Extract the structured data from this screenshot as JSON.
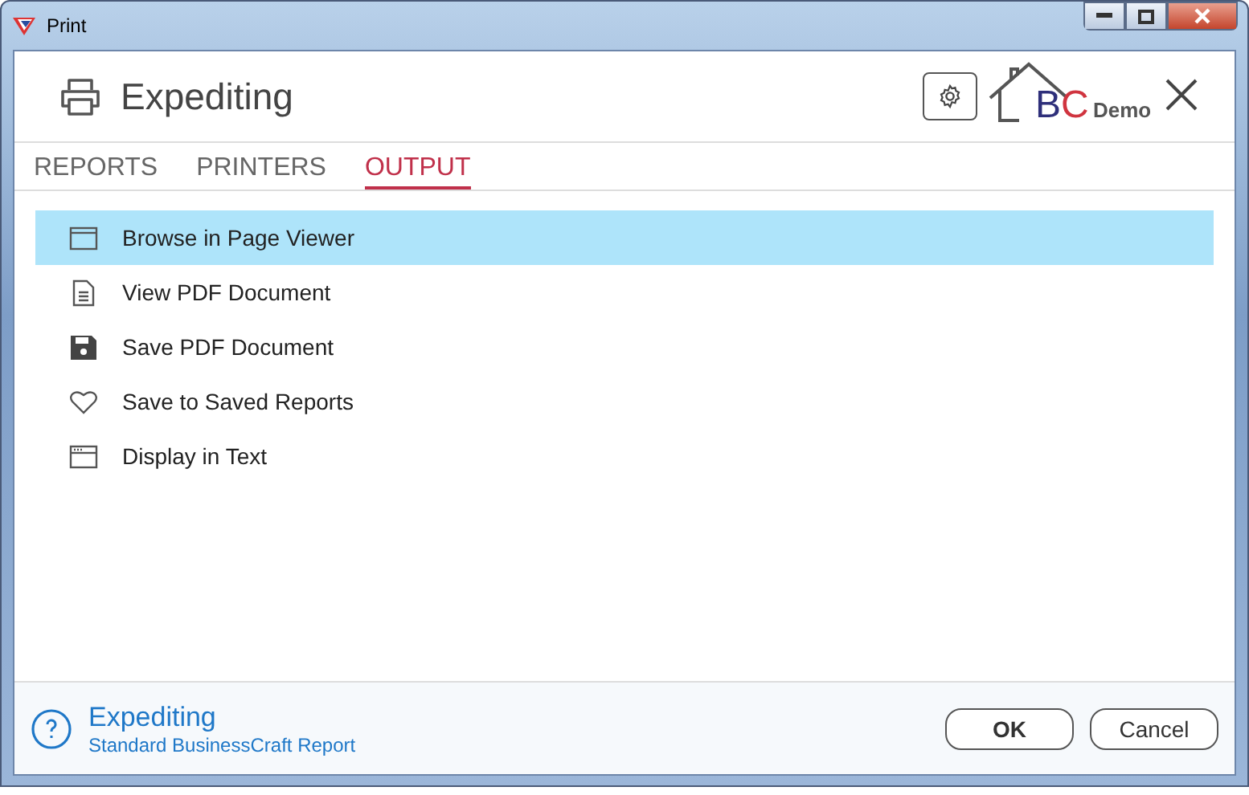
{
  "window": {
    "title": "Print"
  },
  "header": {
    "title": "Expediting",
    "logo": {
      "letters": [
        "B",
        "C"
      ],
      "caption": "Demo"
    }
  },
  "tabs": [
    {
      "label": "REPORTS",
      "selected": false
    },
    {
      "label": "PRINTERS",
      "selected": false
    },
    {
      "label": "OUTPUT",
      "selected": true
    }
  ],
  "outputs": [
    {
      "label": "Browse in Page Viewer",
      "kind": "window",
      "selected": true
    },
    {
      "label": "View PDF Document",
      "kind": "document",
      "selected": false
    },
    {
      "label": "Save PDF Document",
      "kind": "disk",
      "selected": false
    },
    {
      "label": "Save to Saved Reports",
      "kind": "heart",
      "selected": false
    },
    {
      "label": "Display in Text",
      "kind": "text",
      "selected": false
    }
  ],
  "footer": {
    "title": "Expediting",
    "subtitle": "Standard BusinessCraft Report"
  },
  "buttons": [
    "OK",
    "Cancel"
  ]
}
